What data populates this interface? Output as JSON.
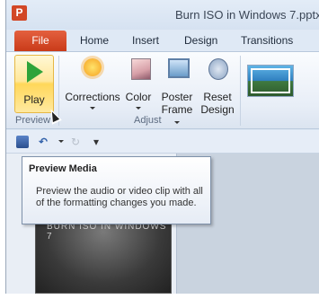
{
  "window": {
    "title": "Burn ISO in Windows 7.pptx",
    "app_icon_letter": "P"
  },
  "tabs": {
    "file": "File",
    "items": [
      "Home",
      "Insert",
      "Design",
      "Transitions"
    ]
  },
  "ribbon": {
    "preview_group_label": "Preview",
    "adjust_group_label": "Adjust",
    "play_label": "Play",
    "corrections_label": "Corrections",
    "color_label": "Color",
    "poster_frame_label_1": "Poster",
    "poster_frame_label_2": "Frame",
    "reset_design_label_1": "Reset",
    "reset_design_label_2": "Design"
  },
  "tooltip": {
    "title": "Preview Media",
    "body": "Preview the audio or video clip with all of the formatting changes you made."
  },
  "slide": {
    "thumb_text": "BURN ISO IN WINDOWS 7"
  },
  "icons": {
    "play": "play-icon",
    "corrections": "sun-icon",
    "color": "photo-icon",
    "poster_frame": "frame-icon",
    "reset_design": "reset-icon",
    "save": "save-icon",
    "undo": "undo-icon",
    "redo": "redo-icon"
  },
  "colors": {
    "file_tab": "#d24726",
    "play_highlight": "#ffd75a",
    "play_triangle": "#2fa33a"
  }
}
